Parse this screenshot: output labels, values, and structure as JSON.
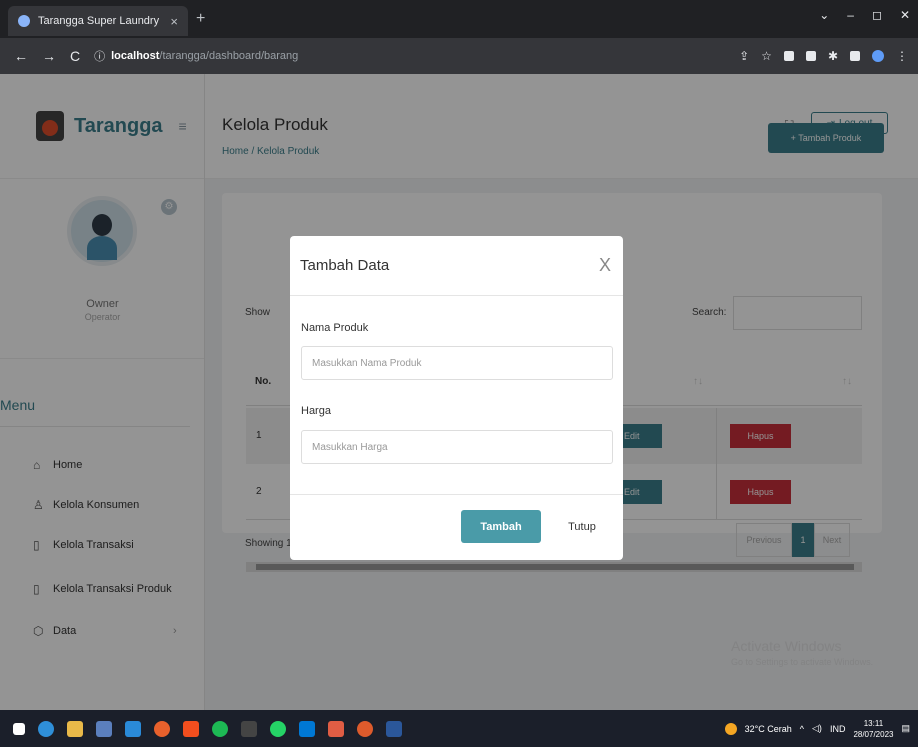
{
  "browser": {
    "tab_title": "Tarangga Super Laundry",
    "tab_close": "×",
    "new_tab": "+",
    "url_host": "localhost",
    "url_path": "/tarangga/dashboard/barang",
    "window_controls": [
      "⌄",
      "–",
      "◻",
      "✕"
    ]
  },
  "sidebar": {
    "brand": "Tarangga",
    "user_name": "Owner",
    "user_role": "Operator",
    "menu_title": "Menu",
    "items": [
      {
        "label": "Home",
        "icon": "home-icon"
      },
      {
        "label": "Kelola Konsumen",
        "icon": "user-icon"
      },
      {
        "label": "Kelola Transaksi",
        "icon": "document-icon"
      },
      {
        "label": "Kelola Transaksi Produk",
        "icon": "document-icon"
      },
      {
        "label": "Data",
        "icon": "box-icon"
      }
    ],
    "data_chevron": "›"
  },
  "topbar": {
    "logout": "Log out"
  },
  "main": {
    "page_title": "Kelola Produk",
    "breadcrumb": "Home / Kelola Produk",
    "add_button": "+ Tambah Produk",
    "show_label": "Show",
    "search_label": "Search:",
    "col_no": "No.",
    "rows": [
      {
        "no": "1",
        "edit": "Edit",
        "hapus": "Hapus"
      },
      {
        "no": "2",
        "edit": "Edit",
        "hapus": "Hapus"
      }
    ],
    "showing_text": "Showing 1",
    "pager": {
      "previous": "Previous",
      "current": "1",
      "next": "Next"
    }
  },
  "modal": {
    "title": "Tambah Data",
    "close": "X",
    "fields": [
      {
        "label": "Nama Produk",
        "placeholder": "Masukkan Nama Produk",
        "value": ""
      },
      {
        "label": "Harga",
        "placeholder": "Masukkan Harga",
        "value": ""
      }
    ],
    "submit": "Tambah",
    "cancel": "Tutup"
  },
  "watermark": {
    "title": "Activate Windows",
    "subtitle": "Go to Settings to activate Windows."
  },
  "taskbar": {
    "weather": "32°C Cerah",
    "lang": "IND",
    "time": "13:11",
    "date": "28/07/2023"
  },
  "colors": {
    "accent": "#3b7f8c",
    "danger": "#c9303c"
  }
}
